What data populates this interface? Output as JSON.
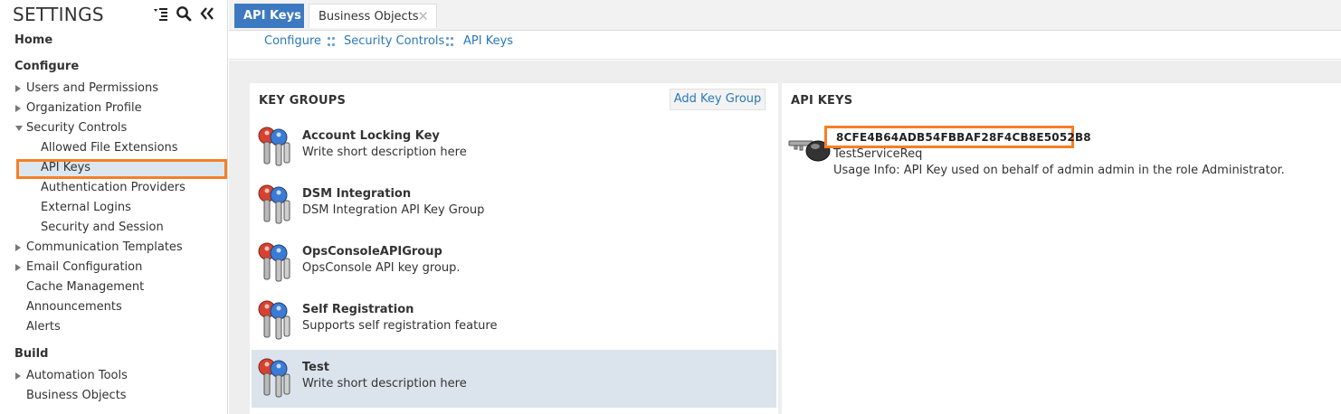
{
  "sidebar": {
    "title": "SETTINGS",
    "tools": [
      "collapse-tree-icon",
      "search-icon",
      "double-chevron-left-icon"
    ],
    "home": "Home",
    "configure": {
      "label": "Configure",
      "items": {
        "users": "Users and Permissions",
        "org": "Organization Profile",
        "security": "Security Controls",
        "allowed_ext": "Allowed File Extensions",
        "api_keys": "API Keys",
        "auth_providers": "Authentication Providers",
        "external_logins": "External Logins",
        "security_session": "Security and Session",
        "comm_templates": "Communication Templates",
        "email_config": "Email Configuration",
        "cache": "Cache Management",
        "announcements": "Announcements",
        "alerts": "Alerts"
      }
    },
    "build": {
      "label": "Build",
      "items": {
        "automation": "Automation Tools",
        "business_objects": "Business Objects"
      }
    }
  },
  "tabs": {
    "active": "API Keys",
    "second": "Business Objects",
    "close_glyph": "✕"
  },
  "breadcrumb": [
    "Configure",
    "Security Controls",
    "API Keys"
  ],
  "key_groups": {
    "title": "KEY GROUPS",
    "add_label": "Add Key Group",
    "items": [
      {
        "name": "Account Locking Key",
        "desc": "Write short description here"
      },
      {
        "name": "DSM Integration",
        "desc": "DSM Integration API Key Group"
      },
      {
        "name": "OpsConsoleAPIGroup",
        "desc": "OpsConsole API key group."
      },
      {
        "name": "Self Registration",
        "desc": "Supports self registration feature"
      },
      {
        "name": "Test",
        "desc": "Write short description here"
      }
    ],
    "selected": "Test"
  },
  "api_keys": {
    "title": "API KEYS",
    "key": "8CFE4B64ADB54FBBAF28F4CB8E5052B8",
    "name": "TestServiceReq",
    "usage": "Usage Info: API Key used on behalf of admin admin in the role Administrator."
  },
  "colors": {
    "tab_active": "#3d79c0",
    "link": "#2a78b8",
    "highlight_border": "#f57f26",
    "selected_row": "#dbe4ec"
  }
}
